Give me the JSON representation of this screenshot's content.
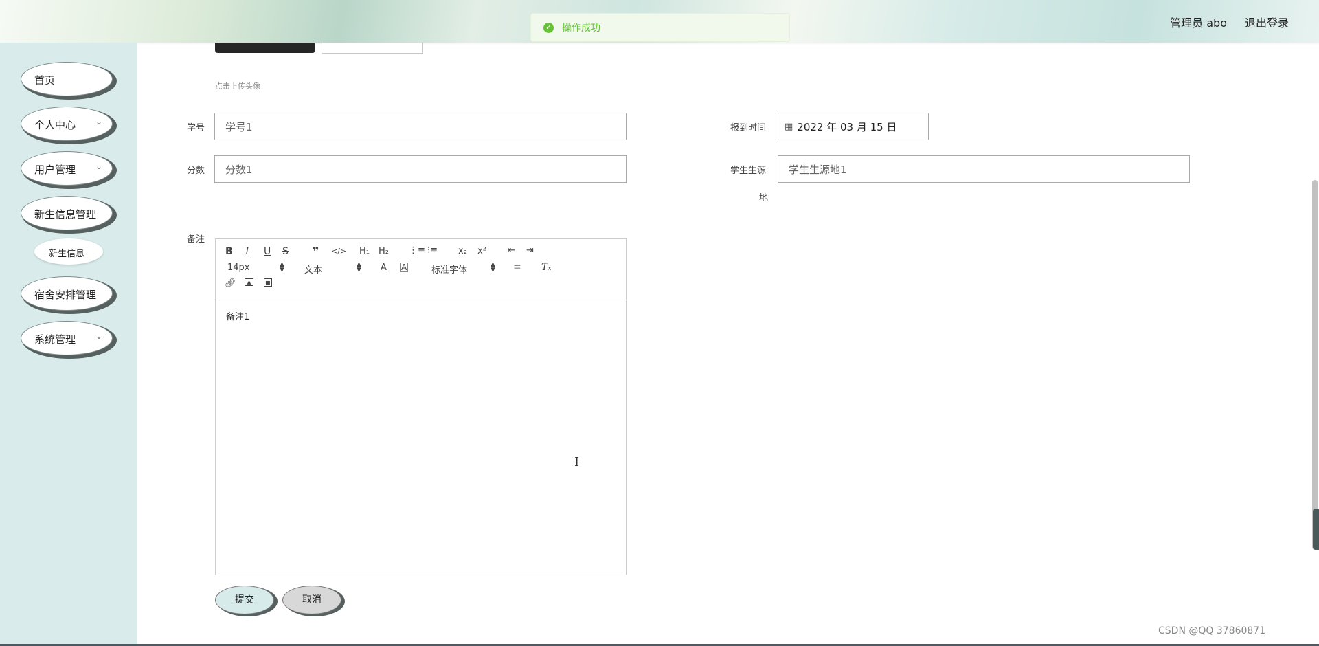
{
  "header": {
    "user_text": "管理员 abo",
    "logout_label": "退出登录"
  },
  "toast": {
    "message": "操作成功"
  },
  "sidebar": {
    "items": [
      {
        "label": "首页"
      },
      {
        "label": "个人中心"
      },
      {
        "label": "用户管理"
      },
      {
        "label": "新生信息管理"
      },
      {
        "label": "宿舍安排管理"
      },
      {
        "label": "系统管理"
      }
    ],
    "subitem": {
      "label": "新生信息"
    }
  },
  "form": {
    "upload_hint": "点击上传头像",
    "student_id": {
      "label": "学号",
      "value": "学号1"
    },
    "score": {
      "label": "分数",
      "value": "分数1"
    },
    "report_time": {
      "label": "报到时间",
      "value": "2022 年 03 月 15 日"
    },
    "origin": {
      "label_line1": "学生生源",
      "label_line2": "地",
      "value": "学生生源地1"
    },
    "remark": {
      "label": "备注",
      "content": "备注1"
    }
  },
  "editor": {
    "font_size": "14px",
    "header": "文本",
    "font_family": "标准字体"
  },
  "buttons": {
    "submit": "提交",
    "cancel": "取消"
  },
  "watermark": {
    "text": "CSDN @QQ 37860871"
  },
  "colors": {
    "sidebar_bg": "#d9ebeb",
    "success": "#67c23a",
    "submit_bg": "#d7ebeb",
    "cancel_bg": "#d8d8d8"
  }
}
